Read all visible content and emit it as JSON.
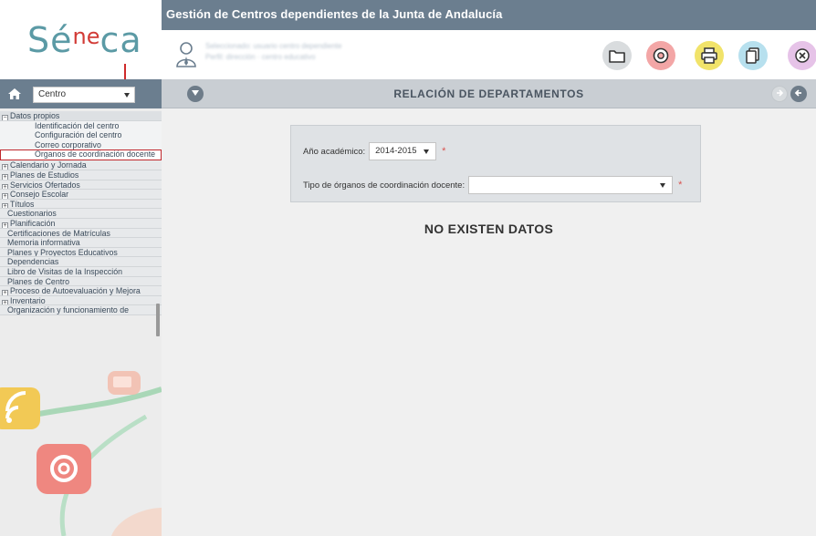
{
  "app": {
    "brand_main": "Séneca",
    "brand_parts": [
      "Sé",
      "ne",
      "ca"
    ],
    "title": "Gestión de Centros dependientes de la Junta de Andalucía"
  },
  "user": {
    "line1": "Seleccionado: usuario centro dependiente",
    "line2": "Perfil: dirección · centro educativo"
  },
  "toolbar": {
    "icons": [
      "folder-icon",
      "support-icon",
      "print-icon",
      "copy-icon",
      "close-icon"
    ]
  },
  "sidebar": {
    "selector_value": "Centro",
    "items": [
      {
        "label": "Datos propios",
        "type": "parent",
        "expanded": true
      },
      {
        "label": "Identificación del centro",
        "type": "child"
      },
      {
        "label": "Configuración del centro",
        "type": "child"
      },
      {
        "label": "Correo corporativo",
        "type": "child"
      },
      {
        "label": "Organos de coordinación docente",
        "type": "child",
        "selected": true
      },
      {
        "label": "Calendario y Jornada",
        "type": "parent"
      },
      {
        "label": "Planes de Estudios",
        "type": "parent"
      },
      {
        "label": "Servicios Ofertados",
        "type": "parent"
      },
      {
        "label": "Consejo Escolar",
        "type": "parent"
      },
      {
        "label": "Títulos",
        "type": "parent"
      },
      {
        "label": "Cuestionarios",
        "type": "leaf"
      },
      {
        "label": "Planificación",
        "type": "parent"
      },
      {
        "label": "Certificaciones de Matrículas",
        "type": "leaf"
      },
      {
        "label": "Memoria informativa",
        "type": "leaf"
      },
      {
        "label": "Planes y Proyectos Educativos",
        "type": "leaf"
      },
      {
        "label": "Dependencias",
        "type": "leaf"
      },
      {
        "label": "Libro de Visitas de la Inspección",
        "type": "leaf"
      },
      {
        "label": "Planes de Centro",
        "type": "leaf"
      },
      {
        "label": "Proceso de Autoevaluación y Mejora",
        "type": "parent"
      },
      {
        "label": "Inventario",
        "type": "parent"
      },
      {
        "label": "Organización y funcionamiento de",
        "type": "leaf"
      }
    ]
  },
  "main": {
    "title": "RELACIÓN DE DEPARTAMENTOS",
    "form": {
      "year_label": "Año académico:",
      "year_value": "2014-2015",
      "tipo_label": "Tipo de órganos de coordinación docente:",
      "tipo_value": "",
      "required_mark": "*"
    },
    "no_data": "NO EXISTEN DATOS"
  },
  "colors": {
    "header_bar": "#6b7e8f",
    "sidebar_bg": "#ececec",
    "main_bg": "#f0f0f0",
    "selected_border": "#c0282d",
    "brand_teal": "#5b9aa5",
    "brand_red": "#d23b36"
  }
}
